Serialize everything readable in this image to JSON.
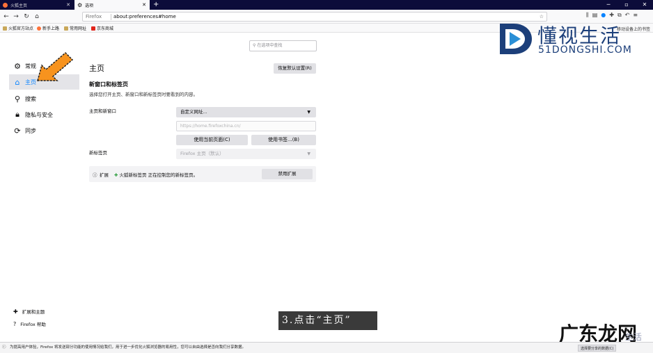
{
  "tabs": [
    {
      "title": "火狐主页",
      "active": false
    },
    {
      "title": "选项",
      "active": true
    }
  ],
  "window_controls": {
    "minimize": "─",
    "maximize": "▫",
    "close": "✕"
  },
  "navbar": {
    "identity": "Firefox",
    "url": "about:preferences#home",
    "icons": [
      "library-icon",
      "sidebar-icon",
      "account-icon",
      "extensions-icon",
      "screenshot-icon",
      "undo-icon",
      "menu-icon"
    ]
  },
  "bookmarks": {
    "items": [
      "火狐官方站点",
      "新手上路",
      "常用网址",
      "京东商城"
    ],
    "right": "移动设备上的书签"
  },
  "sidebar": {
    "categories": [
      {
        "label": "常规",
        "icon": "gear-icon"
      },
      {
        "label": "主页",
        "icon": "home-icon",
        "selected": true
      },
      {
        "label": "搜索",
        "icon": "search-icon"
      },
      {
        "label": "隐私与安全",
        "icon": "lock-icon"
      },
      {
        "label": "同步",
        "icon": "sync-icon"
      }
    ],
    "footer": [
      {
        "label": "扩展和主题",
        "icon": "puzzle-icon"
      },
      {
        "label": "Firefox 帮助",
        "icon": "help-icon"
      }
    ]
  },
  "search": {
    "placeholder": "在选项中查找"
  },
  "main": {
    "title": "主页",
    "restore_button": "恢复默认设置(R)",
    "section_title": "新窗口和标签页",
    "section_desc": "选择您打开主页、新窗口和新标签页时要看到的内容。",
    "homepage_label": "主页和新窗口",
    "homepage_select": "自定义网址...",
    "homepage_url": "https://home.firefoxchina.cn/",
    "use_current_button": "使用当前页面(C)",
    "use_bookmark_button": "使用书签...(B)",
    "newtab_label": "新标签页",
    "newtab_select": "Firefox 主页（默认）",
    "ext_label": "扩展",
    "ext_notice": "火狐新标签页 正在控制您的新标签页。",
    "disable_ext_button": "禁用扩展"
  },
  "caption": "3.点击“主页”",
  "statusbar": {
    "text": "为提高用户体验，Firefox 将发送部分功能的使用情况给我们，用于进一步优化火狐浏览器的易用性，您可以自由选择是否向我们分享数据。",
    "button": "选择要分享的数据(C)"
  },
  "watermarks": {
    "logo_cn": "懂视生活",
    "logo_en": "51DONGSHI.COM",
    "corner": "广东龙网",
    "corner_side": "生活"
  }
}
